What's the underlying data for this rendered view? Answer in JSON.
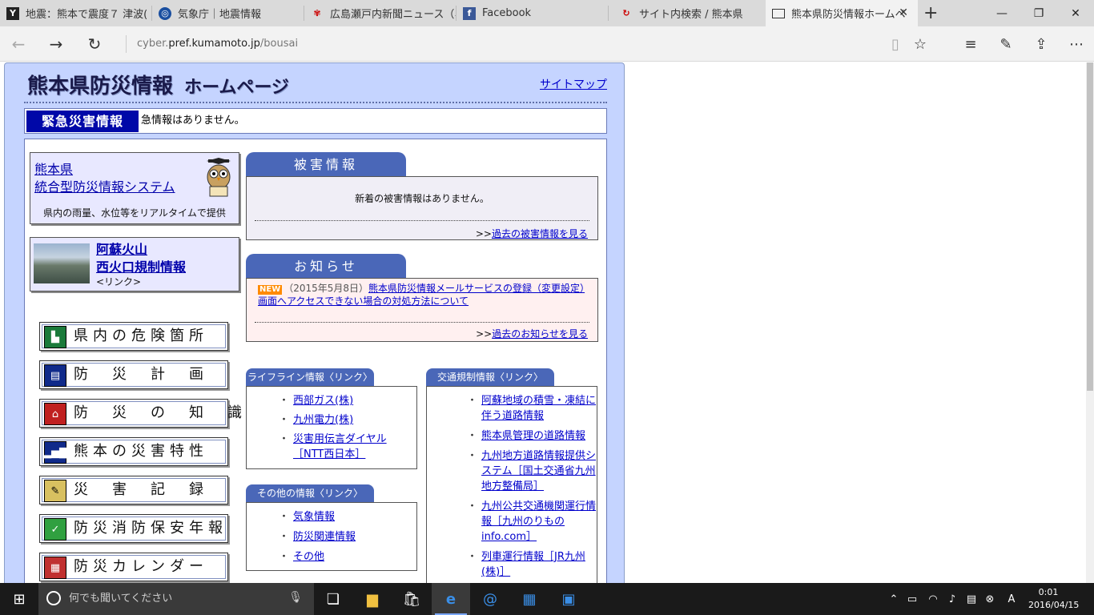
{
  "browser": {
    "tabs": [
      {
        "title": "地震：熊本で震度７ 津波(",
        "icon": "y-icon"
      },
      {
        "title": "気象庁｜地震情報",
        "icon": "jma-icon"
      },
      {
        "title": "広島瀬戸内新聞ニュース（ネ",
        "icon": "news-icon"
      },
      {
        "title": "Facebook",
        "icon": "facebook-icon"
      },
      {
        "title": "サイト内検索 / 熊本県",
        "icon": "kumamoto-icon"
      },
      {
        "title": "熊本県防災情報ホームペ",
        "icon": "page-icon"
      }
    ],
    "address_host": "cyber.",
    "address_domain": "pref.kumamoto.jp",
    "address_path": "/bousai"
  },
  "site": {
    "title": "熊本県防災情報",
    "subtitle": "ホームページ",
    "sitemap": "サイトマップ",
    "emergency_label": "緊急災害情報",
    "emergency_msg": "急情報はありません。",
    "system_line1": "熊本県",
    "system_line2": "統合型防災情報システム",
    "system_desc": "県内の雨量、水位等をリアルタイムで提供",
    "aso_line1": "阿蘇火山",
    "aso_line2": "西火口規制情報",
    "aso_link": "<リンク>",
    "menu": [
      "県内の危険箇所",
      "防　災　計　画",
      "防　災　の　知　識",
      "熊本の災害特性",
      "災　害　記　録",
      "防災消防保安年報",
      "防災カレンダー"
    ],
    "damage": {
      "tab": "被害情報",
      "msg": "新着の被害情報はありません。",
      "more_prefix": ">>",
      "more": "過去の被害情報を見る"
    },
    "notice": {
      "tab": "お知らせ",
      "badge": "NEW",
      "date": "（2015年5月8日）",
      "text": "熊本県防災情報メールサービスの登録（変更設定）画面へアクセスできない場合の対処方法について",
      "more_prefix": ">>",
      "more": "過去のお知らせを見る"
    },
    "lifeline": {
      "tab": "ライフライン情報〈リンク〉",
      "items": [
        "西部ガス(株)",
        "九州電力(株)",
        "災害用伝言ダイヤル［NTT西日本］"
      ]
    },
    "other": {
      "tab": "その他の情報〈リンク〉",
      "items": [
        "気象情報",
        "防災関連情報",
        "その他"
      ]
    },
    "traffic": {
      "tab": "交通規制情報〈リンク〉",
      "items": [
        "阿蘇地域の積雪・凍結に伴う道路情報",
        "熊本県管理の道路情報",
        "九州地方道路情報提供システム［国土交通省九州地方整備局］",
        "九州公共交通機関運行情報［九州のりもの info.com］",
        "列車運行情報［JR九州(株)］"
      ]
    }
  },
  "taskbar": {
    "search_placeholder": "何でも聞いてください",
    "time": "0:01",
    "date": "2016/04/15"
  }
}
